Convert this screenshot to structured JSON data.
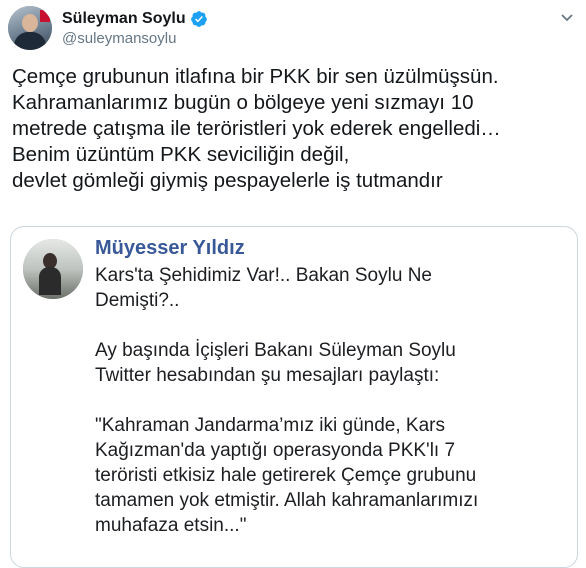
{
  "author": {
    "display_name": "Süleyman Soylu",
    "handle": "@suleymansoylu",
    "verified_color": "#1da1f2"
  },
  "tweet": {
    "text": "Çemçe grubunun itlafına bir PKK bir sen üzülmüşsün.\nKahramanlarımız bugün o bölgeye yeni sızmayı 10\nmetrede çatışma ile teröristleri yok ederek engelledi…\nBenim üzüntüm PKK seviciliğin değil,\ndevlet gömleği giymiş pespayelerle iş tutmandır"
  },
  "quoted_post": {
    "author_name": "Müyesser Yıldız",
    "author_color": "#385898",
    "text": "Kars'ta Şehidimiz Var!.. Bakan Soylu Ne\nDemişti?..\n\nAy başında İçişleri Bakanı Süleyman Soylu\nTwitter hesabından şu mesajları paylaştı:\n\n\"Kahraman Jandarma’mız iki günde, Kars\nKağızman'da yaptığı operasyonda PKK'lı 7\nteröristi etkisiz hale getirerek Çemçe grubunu\ntamamen yok etmiştir. Allah kahramanlarımızı\nmuhafaza etsin...\""
  },
  "icons": {
    "verified": "verified-badge-icon",
    "more": "chevron-down-icon"
  }
}
